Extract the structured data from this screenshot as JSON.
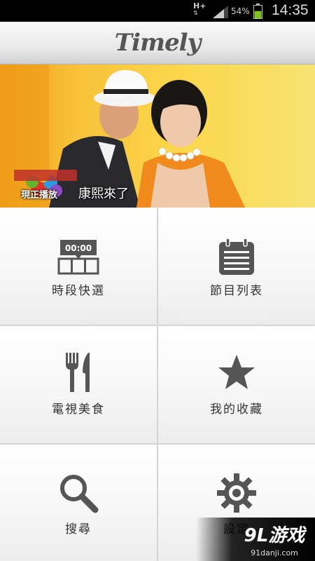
{
  "status_bar": {
    "network": "H+",
    "battery_percent": "54%",
    "battery_level": 0.54,
    "time": "14:35"
  },
  "app": {
    "title": "Timely"
  },
  "banner": {
    "badge": "現正播放",
    "program": "康熙來了"
  },
  "menu": {
    "items": [
      {
        "label": "時段快選",
        "icon": "clock-schedule-icon",
        "clock": "00:00"
      },
      {
        "label": "節目列表",
        "icon": "calendar-list-icon"
      },
      {
        "label": "電視美食",
        "icon": "fork-knife-icon"
      },
      {
        "label": "我的收藏",
        "icon": "star-icon"
      },
      {
        "label": "搜尋",
        "icon": "search-icon"
      },
      {
        "label": "設定",
        "icon": "gear-icon"
      }
    ]
  },
  "watermark": {
    "brand": "9L游戏",
    "site": "91danji.com"
  },
  "colors": {
    "icon": "#555555",
    "text": "#333333",
    "divider": "#d4d4d4"
  }
}
